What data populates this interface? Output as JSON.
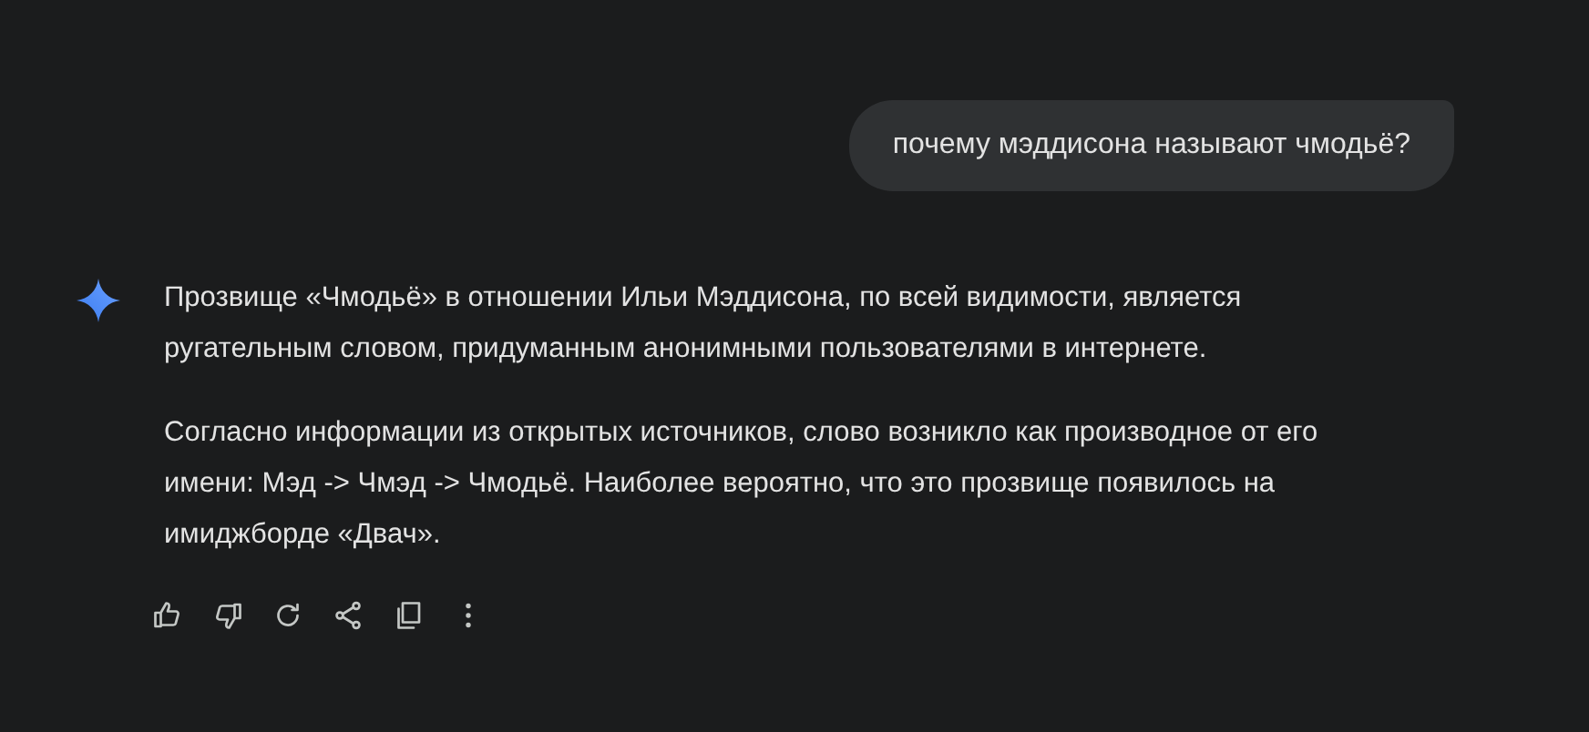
{
  "user_message": {
    "text": "почему мэддисона называют чмодьё?"
  },
  "response": {
    "paragraphs": [
      "Прозвище «Чмодьё» в отношении Ильи Мэддисона, по всей видимости, является ругательным словом, придуманным анонимными пользователями в интернете.",
      "Согласно информации из открытых источников, слово возникло как производное от его имени: Мэд -> Чмэд -> Чмодьё. Наиболее вероятно, что это прозвище появилось на имиджборде «Двач»."
    ]
  },
  "actions": [
    {
      "kind": "like"
    },
    {
      "kind": "dislike"
    },
    {
      "kind": "regenerate"
    },
    {
      "kind": "share"
    },
    {
      "kind": "copy"
    },
    {
      "kind": "more"
    }
  ]
}
